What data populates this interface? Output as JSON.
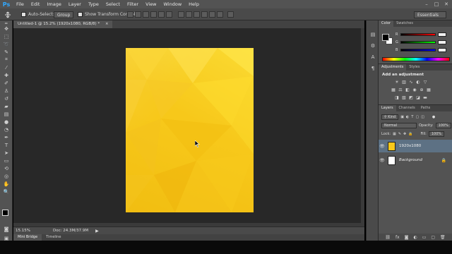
{
  "app": {
    "logo": "Ps"
  },
  "menu": [
    "File",
    "Edit",
    "Image",
    "Layer",
    "Type",
    "Select",
    "Filter",
    "View",
    "Window",
    "Help"
  ],
  "window_controls": {
    "minimize": "–",
    "maximize": "□",
    "close": "✕"
  },
  "options_bar": {
    "auto_select_label": "Auto-Select:",
    "auto_select_value": "Group",
    "show_transform_label": "Show Transform Controls",
    "workspace": "Essentials"
  },
  "document": {
    "tab_title": "Untitled-1 @ 15.2% (1920x1080, RGB/8) *",
    "tab_close": "×",
    "zoom": "15.15%",
    "doc_info": "Doc: 24.3M/37.9M",
    "artboard_color": "#f7c81a"
  },
  "bottom_tabs": [
    "Mini Bridge",
    "Timeline"
  ],
  "panels": {
    "color_tabs": [
      "Color",
      "Swatches"
    ],
    "color_sliders": [
      {
        "label": "R",
        "track": "linear-gradient(90deg,#000,#f00)"
      },
      {
        "label": "G",
        "track": "linear-gradient(90deg,#000,#0f0)"
      },
      {
        "label": "B",
        "track": "linear-gradient(90deg,#000,#00f)"
      }
    ],
    "adjustments_tabs": [
      "Adjustments",
      "Styles"
    ],
    "adjustments_title": "Add an adjustment",
    "layers_tabs": [
      "Layers",
      "Channels",
      "Paths"
    ],
    "kind_filter": "Kind",
    "blend_mode": "Normal",
    "opacity_label": "Opacity:",
    "opacity_value": "100%",
    "lock_label": "Lock:",
    "fill_label": "Fill:",
    "fill_value": "100%",
    "layers": [
      {
        "name": "1920x1080",
        "thumb": "#f7c81a",
        "selected": true
      },
      {
        "name": "Background",
        "thumb": "#ffffff",
        "selected": false
      }
    ]
  },
  "colors": {
    "accent": "#31a8ff",
    "selection": "#5d7184"
  }
}
